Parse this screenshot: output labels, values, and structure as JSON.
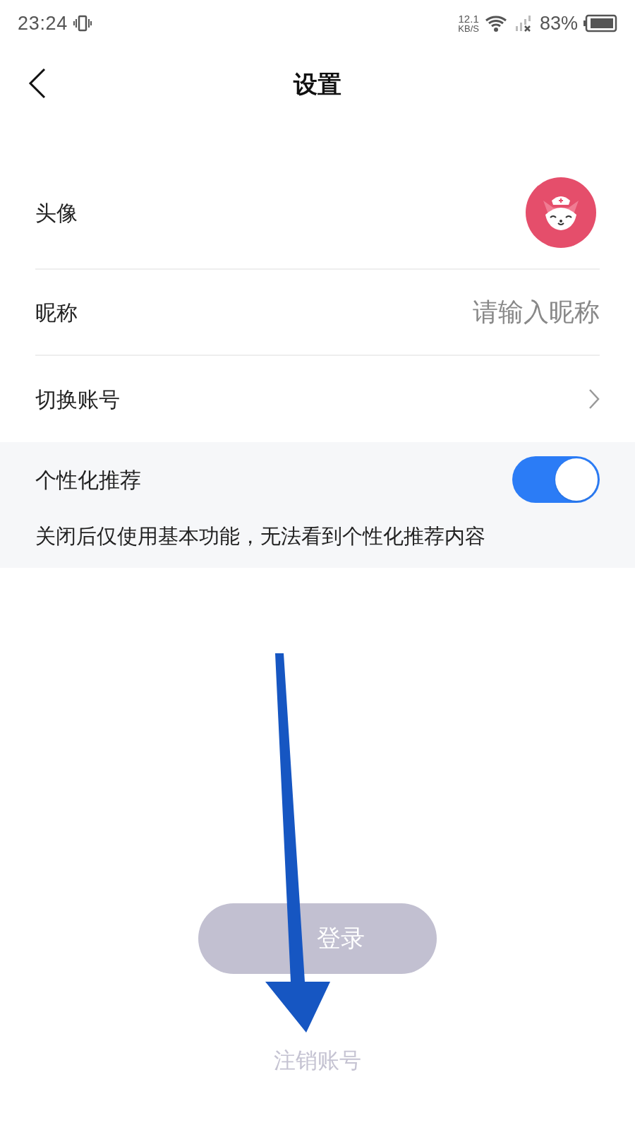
{
  "status_bar": {
    "time": "23:24",
    "speed_value": "12.1",
    "speed_unit": "KB/S",
    "battery": "83%"
  },
  "header": {
    "title": "设置"
  },
  "settings": [
    {
      "kind": "avatar",
      "label": "头像"
    },
    {
      "kind": "input",
      "label": "昵称",
      "placeholder": "请输入昵称"
    },
    {
      "kind": "link",
      "label": "切换账号"
    }
  ],
  "personalization": {
    "label": "个性化推荐",
    "on": true,
    "description": "关闭后仅使用基本功能，无法看到个性化推荐内容"
  },
  "logout_button": {
    "label": "登录",
    "disabled": true
  },
  "cancel_account": {
    "label": "注销账号"
  }
}
